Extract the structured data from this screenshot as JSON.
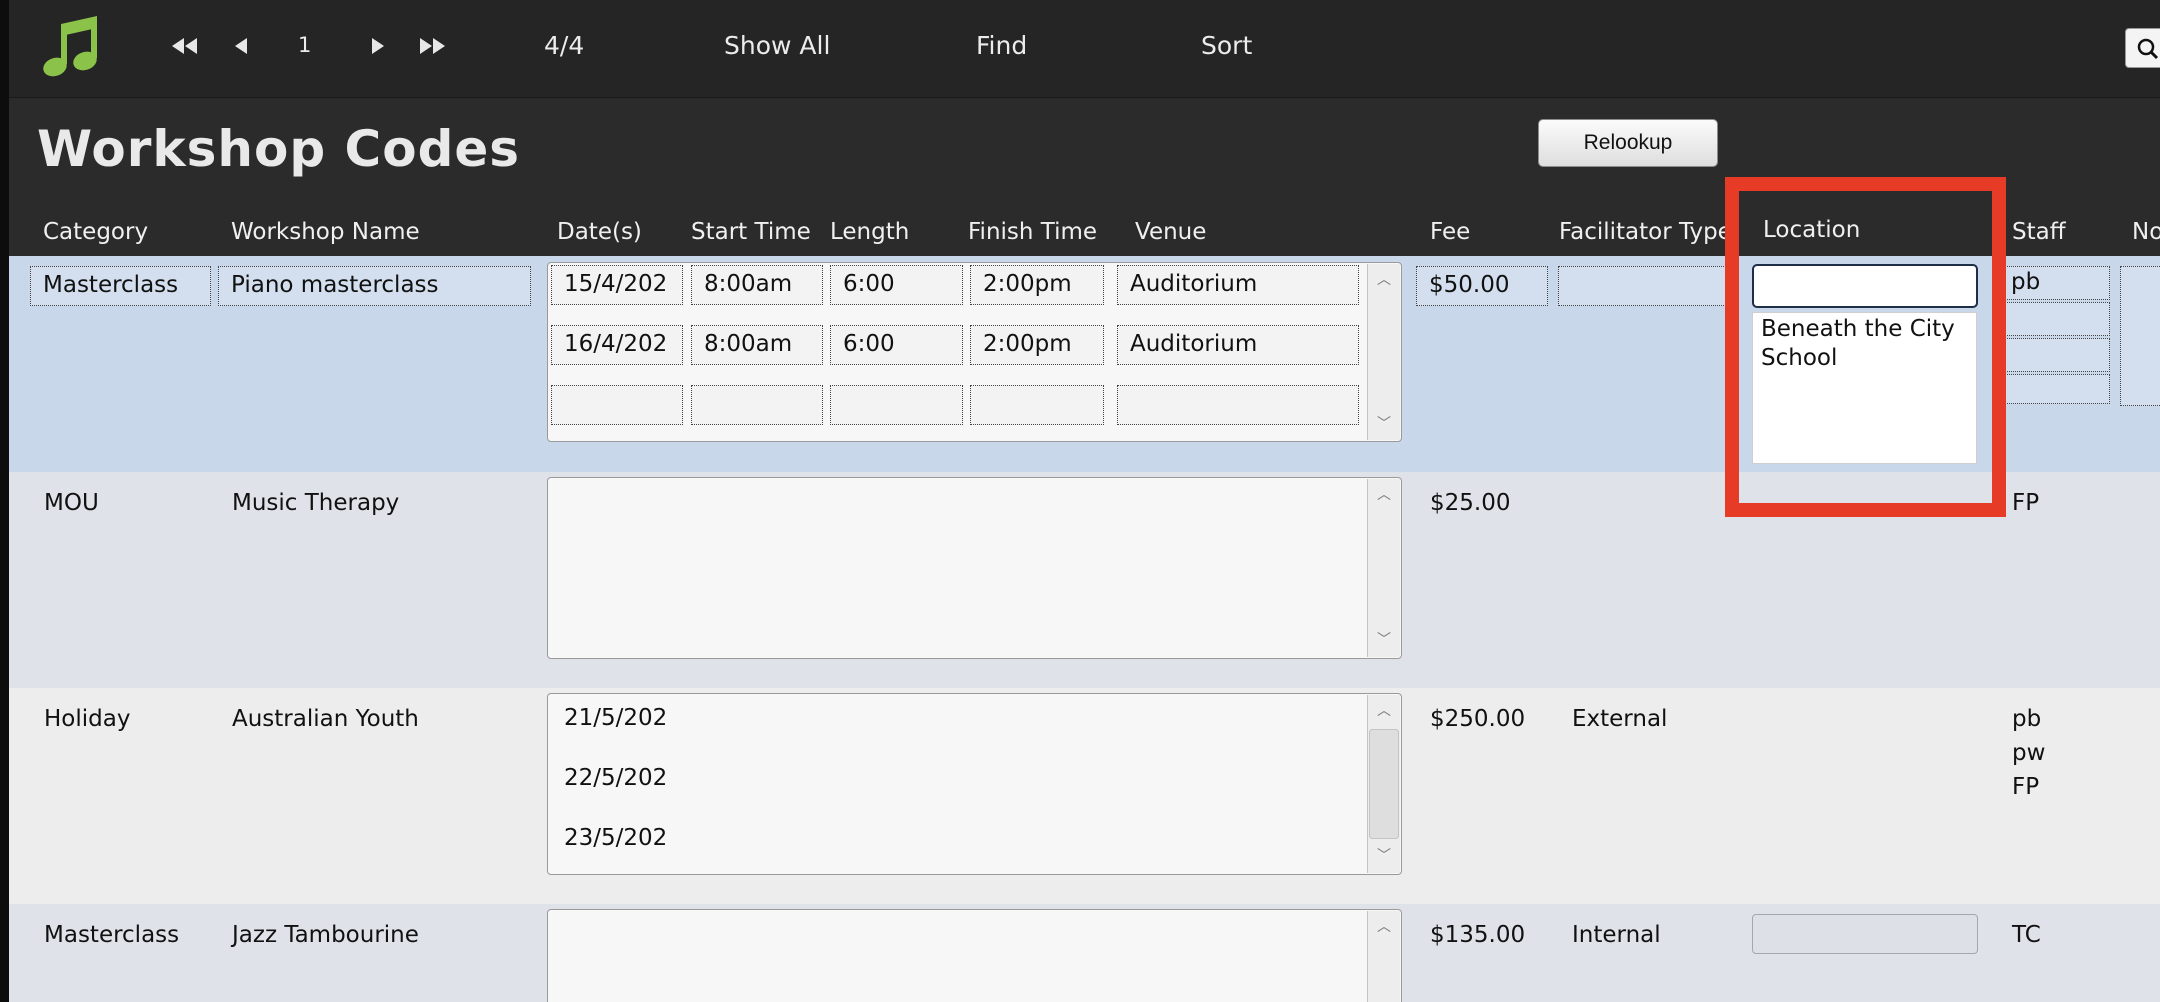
{
  "toolbar": {
    "record_number": "1",
    "record_count": "4/4",
    "show_all": "Show All",
    "find": "Find",
    "sort": "Sort"
  },
  "header": {
    "title": "Workshop Codes",
    "relookup": "Relookup",
    "columns": {
      "category": "Category",
      "workshop_name": "Workshop Name",
      "dates": "Date(s)",
      "start_time": "Start Time",
      "length": "Length",
      "finish_time": "Finish Time",
      "venue": "Venue",
      "fee": "Fee",
      "facilitator_type": "Facilitator Type",
      "location": "Location",
      "staff": "Staff",
      "notes": "No"
    }
  },
  "rows": [
    {
      "category": "Masterclass",
      "workshop_name": "Piano masterclass",
      "sessions": [
        {
          "date": "15/4/202",
          "start": "8:00am",
          "length": "6:00",
          "finish": "2:00pm",
          "venue": "Auditorium"
        },
        {
          "date": "16/4/202",
          "start": "8:00am",
          "length": "6:00",
          "finish": "2:00pm",
          "venue": "Auditorium"
        },
        {
          "date": "",
          "start": "",
          "length": "",
          "finish": "",
          "venue": ""
        }
      ],
      "fee": "$50.00",
      "facilitator_type": "",
      "location": "",
      "location_options": [
        "Beneath the City School"
      ],
      "staff": [
        "pb",
        "",
        "",
        ""
      ]
    },
    {
      "category": "MOU",
      "workshop_name": "Music Therapy",
      "sessions": [],
      "fee": "$25.00",
      "facilitator_type": "",
      "location": "",
      "staff": [
        "FP"
      ]
    },
    {
      "category": "Holiday",
      "workshop_name": "Australian Youth",
      "sessions": [
        {
          "date": "21/5/202"
        },
        {
          "date": "22/5/202"
        },
        {
          "date": "23/5/202"
        }
      ],
      "fee": "$250.00",
      "facilitator_type": "External",
      "location": "",
      "staff": [
        "pb",
        "pw",
        "FP"
      ]
    },
    {
      "category": "Masterclass",
      "workshop_name": "Jazz Tambourine",
      "sessions": [],
      "fee": "$135.00",
      "facilitator_type": "Internal",
      "location": "",
      "staff": [
        "TC"
      ]
    }
  ],
  "colors": {
    "toolbar_bg": "#252525",
    "header_bg": "#2b2b2b",
    "selected_row": "#c8d7ea",
    "row_alt": "#dfe2e8",
    "row_light": "#ededed",
    "logo_green": "#8bc34a",
    "highlight_red": "#e63c27"
  },
  "icons": [
    "music-note-icon",
    "first-record-icon",
    "previous-record-icon",
    "next-record-icon",
    "last-record-icon",
    "search-icon"
  ]
}
